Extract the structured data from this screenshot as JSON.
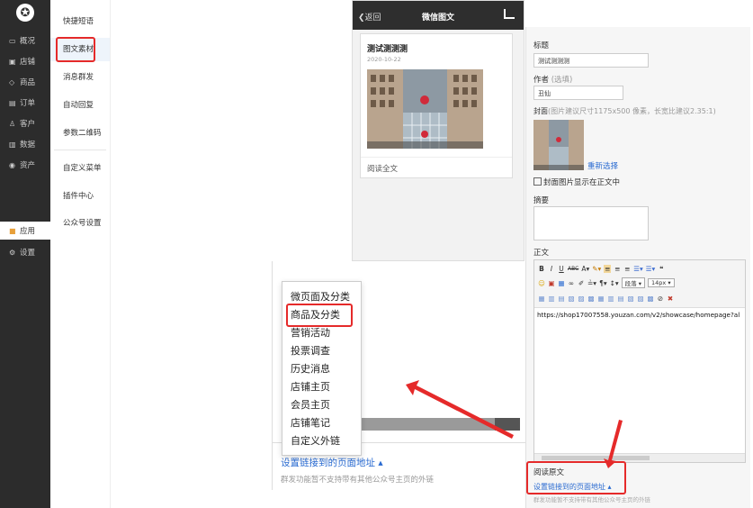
{
  "sidebar": {
    "logo_glyph": "✪",
    "items": [
      {
        "icon": "▭",
        "label": "概况"
      },
      {
        "icon": "▣",
        "label": "店铺"
      },
      {
        "icon": "◇",
        "label": "商品"
      },
      {
        "icon": "▤",
        "label": "订单"
      },
      {
        "icon": "♙",
        "label": "客户"
      },
      {
        "icon": "▥",
        "label": "数据"
      },
      {
        "icon": "◉",
        "label": "资产"
      },
      {
        "icon": "■",
        "label": "应用"
      },
      {
        "icon": "⚙",
        "label": "设置"
      }
    ],
    "active_index": 7
  },
  "subnav": {
    "items": [
      "快捷短语",
      "图文素材",
      "消息群发",
      "自动回复",
      "参数二维码",
      "自定义菜单",
      "插件中心",
      "公众号设置"
    ],
    "selected_index": 1
  },
  "phone": {
    "back_label": "返回",
    "title": "微信图文",
    "card": {
      "title": "测试测测测",
      "date": "2020-10-22",
      "read_more": "阅读全文"
    }
  },
  "editor_panel": {
    "title_label": "标题",
    "title_value": "测试测测测",
    "author_label": "作者",
    "author_hint": "(选填)",
    "author_value": "丑仙",
    "cover_label": "封面",
    "cover_hint": "(图片建议尺寸1175x500 像素，长宽比建议2.35:1)",
    "cover_reselect": "重新选择",
    "cover_show_in_body": "封面图片显示在正文中",
    "abstract_label": "摘要",
    "body_label": "正文",
    "toolbar": {
      "row1": [
        "B",
        "I",
        "U",
        "ABC",
        "A▾",
        "✎▾",
        "≡",
        "≡",
        "≡",
        "☰▾",
        "☰▾",
        "❝"
      ],
      "row2": [
        "☺",
        "▣",
        "▦",
        "∞",
        "✐",
        "≟▾",
        "¶▾",
        "↕▾"
      ],
      "paragraph_select": "段落",
      "font_size_select": "14px",
      "row3": [
        "▦",
        "▥",
        "▤",
        "▧",
        "▨",
        "▩",
        "▦",
        "▥",
        "▤",
        "▧",
        "▨",
        "▩",
        "⊘",
        "✖"
      ]
    },
    "body_content": "https://shop17007558.youzan.com/v2/showcase/homepage?al",
    "read_original_label": "阅读原文",
    "link_setting_label": "设置链接到的页面地址",
    "link_note": "群发功能暂不支持带有其他公众号主页的外链"
  },
  "bottom_panel": {
    "link_setting_label": "设置链接到的页面地址",
    "link_note": "群发功能暂不支持带有其他公众号主页的外链"
  },
  "link_menu": {
    "items": [
      "微页面及分类",
      "商品及分类",
      "营销活动",
      "投票调查",
      "历史消息",
      "店铺主页",
      "会员主页",
      "店铺笔记",
      "自定义外链"
    ],
    "highlighted_index": 1
  },
  "colors": {
    "highlight_box": "#e52a2a",
    "link_blue": "#2a6bd1",
    "sidebar_bg": "#2c2c2c"
  }
}
